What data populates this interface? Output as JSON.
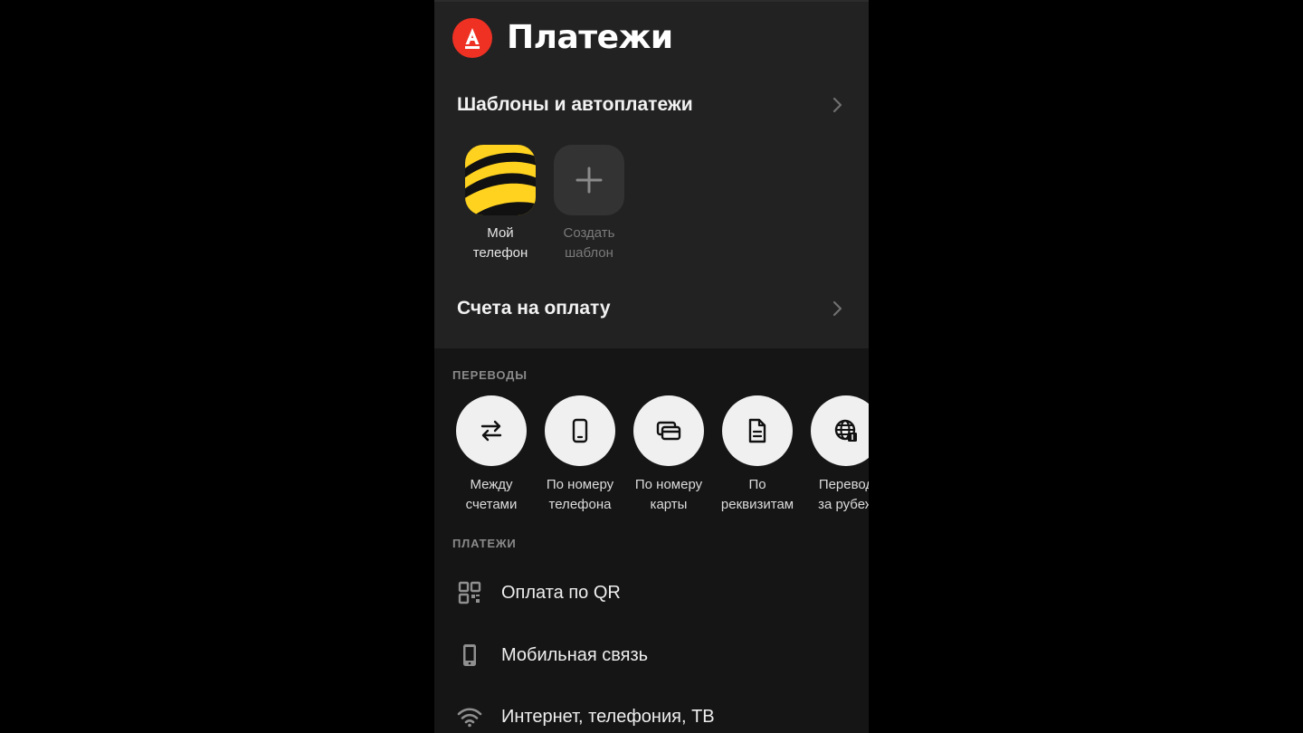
{
  "header": {
    "logo_letter": "А",
    "title": "Платежи",
    "brand_color": "#ef3124",
    "logo_icon": "alfa-logo-icon"
  },
  "sections": {
    "templates": {
      "label": "Шаблоны и автоплатежи",
      "icon": "chevron-right-icon"
    },
    "invoices": {
      "label": "Счета на оплату",
      "icon": "chevron-right-icon"
    }
  },
  "templates": [
    {
      "line1": "Мой",
      "line2": "телефон",
      "icon": "beeline-logo-icon"
    },
    {
      "line1": "Создать",
      "line2": "шаблон",
      "icon": "plus-icon"
    }
  ],
  "transfers": {
    "caption": "ПЕРЕВОДЫ",
    "items": [
      {
        "label": "Между\nсчетами",
        "icon": "swap-arrows-icon"
      },
      {
        "label": "По номеру\nтелефона",
        "icon": "smartphone-icon"
      },
      {
        "label": "По номеру\nкарты",
        "icon": "card-icon"
      },
      {
        "label": "По\nреквизитам",
        "icon": "document-icon"
      },
      {
        "label": "Перевод\nза рубеж",
        "icon": "globe-icon"
      }
    ]
  },
  "payments": {
    "caption": "ПЛАТЕЖИ",
    "items": [
      {
        "label": "Оплата по QR",
        "icon": "qr-code-icon"
      },
      {
        "label": "Мобильная связь",
        "icon": "mobile-phone-icon"
      },
      {
        "label": "Интернет, телефония, ТВ",
        "icon": "wifi-icon"
      }
    ]
  }
}
